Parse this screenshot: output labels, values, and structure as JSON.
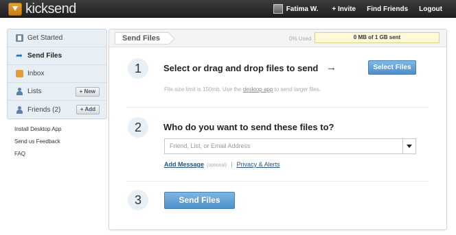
{
  "header": {
    "logo_text": "kicksend",
    "user_name": "Fatima W.",
    "links": [
      "+ Invite",
      "Find Friends",
      "Logout"
    ]
  },
  "sidebar": {
    "items": [
      {
        "label": "Get Started",
        "icon": "document-icon"
      },
      {
        "label": "Send Files",
        "icon": "send-arrow-icon"
      },
      {
        "label": "Inbox",
        "icon": "inbox-icon"
      },
      {
        "label": "Lists",
        "icon": "person-icon",
        "action": "+ New"
      },
      {
        "label": "Friends (2)",
        "icon": "person-icon",
        "action": "+ Add"
      }
    ],
    "links": [
      "Install Desktop App",
      "Send us Feedback",
      "FAQ"
    ]
  },
  "panel": {
    "breadcrumb": "Send Files",
    "usage_label": "0% Used",
    "usage_value": "0 MB of 1 GB sent",
    "usage_percent": 0
  },
  "step1": {
    "number": "1",
    "heading": "Select or drag and drop files to send",
    "arrow": "→",
    "button": "Select Files",
    "hint_before": "File size limit is 150mb. Use the ",
    "hint_link": "desktop app",
    "hint_after": " to send larger files."
  },
  "step2": {
    "number": "2",
    "heading": "Who do you want to send these files to?",
    "placeholder": "Friend, List, or Email Address",
    "add_message": "Add Message",
    "optional": "(optional)",
    "separator": "|",
    "privacy": "Privacy & Alerts"
  },
  "step3": {
    "number": "3",
    "button": "Send Files"
  }
}
